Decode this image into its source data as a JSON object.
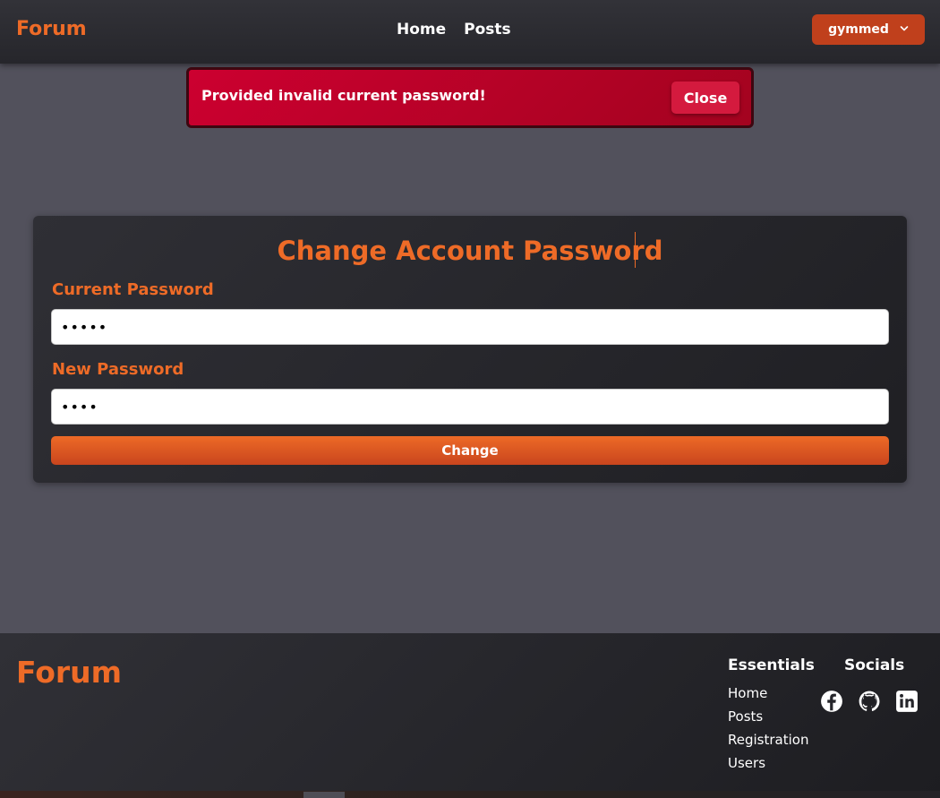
{
  "navbar": {
    "brand": "Forum",
    "links": [
      "Home",
      "Posts"
    ],
    "user": "gymmed"
  },
  "alert": {
    "message": "Provided invalid current password!",
    "close_label": "Close"
  },
  "form": {
    "title": "Change Account Password",
    "current_label": "Current Password",
    "current_value": "•••••",
    "new_label": "New Password",
    "new_value": "••••",
    "submit_label": "Change"
  },
  "footer": {
    "brand": "Forum",
    "essentials_heading": "Essentials",
    "essentials_links": [
      "Home",
      "Posts",
      "Registration",
      "Users"
    ],
    "socials_heading": "Socials",
    "socials": [
      "facebook-icon",
      "github-icon",
      "linkedin-icon"
    ]
  },
  "colors": {
    "accent": "#ee6b27",
    "alert": "#cc0030",
    "background": "#52515c"
  }
}
